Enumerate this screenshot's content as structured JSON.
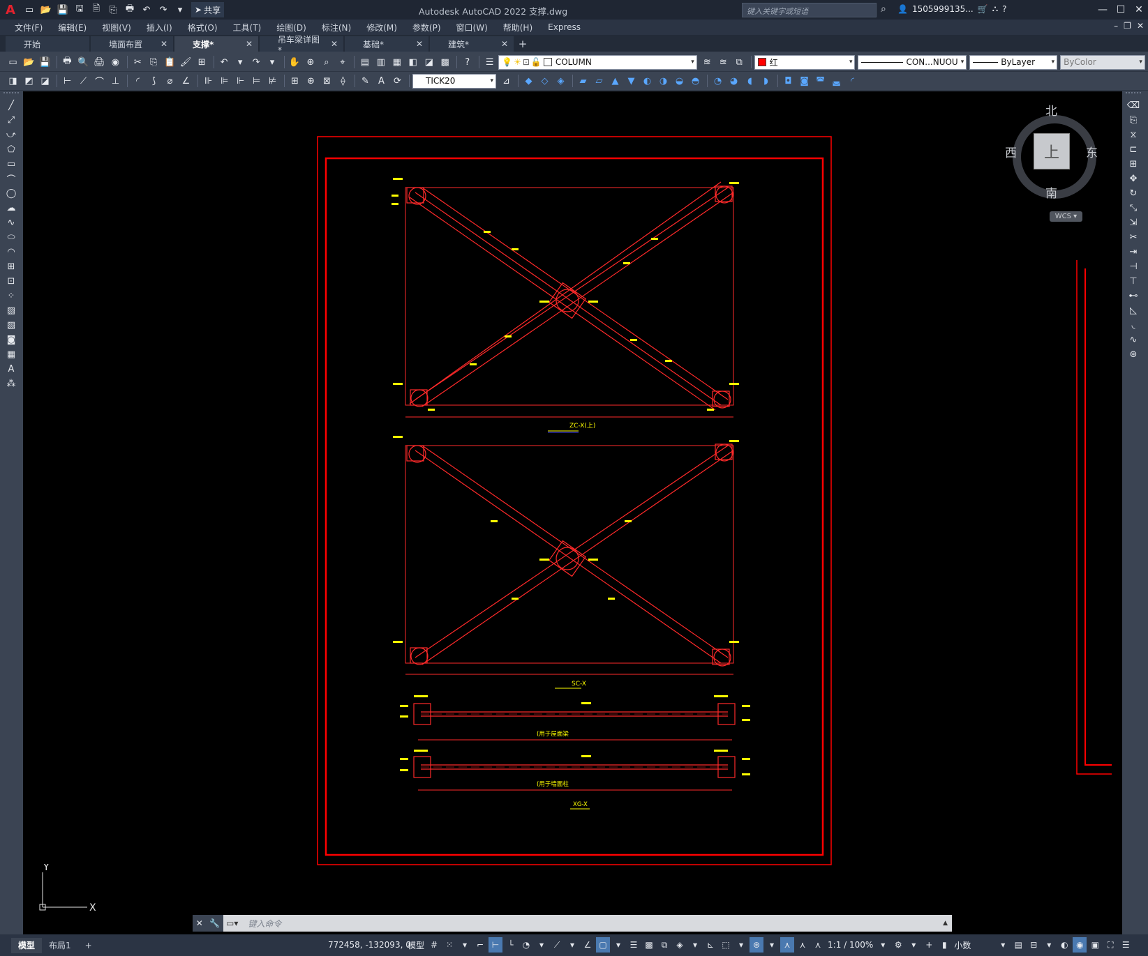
{
  "titlebar": {
    "app_title": "Autodesk AutoCAD 2022    支撑.dwg",
    "share_label": "共享",
    "search_placeholder": "键入关键字或短语",
    "user_label": "1505999135...",
    "win_min": "—",
    "win_max": "☐",
    "win_close": "✕"
  },
  "menu": {
    "items": [
      "文件(F)",
      "编辑(E)",
      "视图(V)",
      "插入(I)",
      "格式(O)",
      "工具(T)",
      "绘图(D)",
      "标注(N)",
      "修改(M)",
      "参数(P)",
      "窗口(W)",
      "帮助(H)",
      "Express"
    ]
  },
  "tabs": [
    {
      "label": "开始",
      "closable": false,
      "active": false
    },
    {
      "label": "墙面布置",
      "closable": true,
      "active": false
    },
    {
      "label": "支撑*",
      "closable": true,
      "active": true
    },
    {
      "label": "吊车梁详图*",
      "closable": true,
      "active": false
    },
    {
      "label": "基础*",
      "closable": true,
      "active": false
    },
    {
      "label": "建筑*",
      "closable": true,
      "active": false
    }
  ],
  "properties": {
    "layer": "COLUMN",
    "color": "红",
    "color_hex": "#ff0000",
    "linetype": "CON...NUOU",
    "lineweight": "ByLayer",
    "plotstyle": "ByColor",
    "dimstyle": "TICK20"
  },
  "viewcube": {
    "north": "北",
    "south": "南",
    "east": "东",
    "west": "西",
    "face": "上",
    "wcs": "WCS"
  },
  "ucs": {
    "x": "X",
    "y": "Y"
  },
  "drawing": {
    "labels": {
      "elev1": "ZC-X(上)",
      "elev2": "SC-X",
      "beam1": "(用于屋面梁",
      "beam2": "(用于墙面柱",
      "beam_title": "XG-X"
    },
    "colors": {
      "frame": "#ff0000",
      "annotation": "#ffff00",
      "line": "#ff2a2a"
    }
  },
  "commandline": {
    "placeholder": "键入命令"
  },
  "statusbar": {
    "layout_tabs": [
      "模型",
      "布局1"
    ],
    "coords": "772458, -132093, 0",
    "model_label": "模型",
    "scale": "1:1 / 100%",
    "units": "小数"
  }
}
